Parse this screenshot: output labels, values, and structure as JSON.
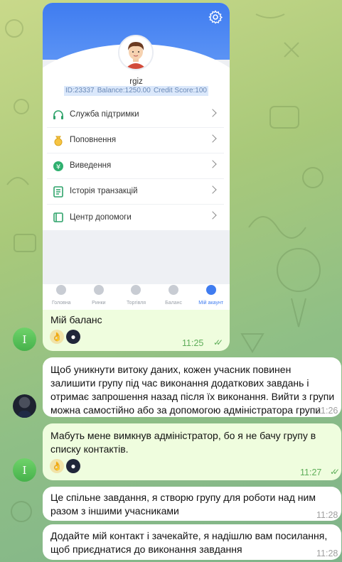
{
  "colors": {
    "accent": "#3f7cf0",
    "outgoing_bubble": "#effdde",
    "incoming_bubble": "#ffffff",
    "read_check": "#5fae5a"
  },
  "screenshot": {
    "username": "rgiz",
    "id": "ID:23337",
    "balance": "Balance:1250.00",
    "credit": "Credit Score:100",
    "menu": [
      {
        "label": "Служба підтримки",
        "icon": "headset-icon"
      },
      {
        "label": "Поповнення",
        "icon": "coin-bag-icon"
      },
      {
        "label": "Виведення",
        "icon": "yuan-coin-icon"
      },
      {
        "label": "Історія транзакцій",
        "icon": "document-icon"
      },
      {
        "label": "Центр допомоги",
        "icon": "book-icon"
      }
    ],
    "tabs": [
      {
        "label": "Головна"
      },
      {
        "label": "Ринки"
      },
      {
        "label": "Торгівля"
      },
      {
        "label": "Баланс"
      },
      {
        "label": "Мій акаунт"
      }
    ]
  },
  "messages": [
    {
      "text": "Мій баланс",
      "time": "11:25"
    },
    {
      "text": "Щоб уникнути витоку даних, кожен учасник повинен залишити групу під час виконання додаткових завдань і отримає запрошення назад після їх виконання. Вийти з групи можна самостійно або за допомогою адміністратора групи",
      "time": "11:26"
    },
    {
      "text": "Мабуть мене вимкнув адміністратор, бо я не бачу групу в списку контактів.",
      "time": "11:27"
    },
    {
      "text": "Це спільне завдання, я створю групу для роботи над ним разом з іншими учасниками",
      "time": "11:28"
    },
    {
      "text": "Додайте мій контакт і зачекайте, я надішлю вам посилання, щоб приєднатися до виконання завдання",
      "time": "11:28"
    }
  ],
  "avatars": {
    "me_initial": "I"
  }
}
